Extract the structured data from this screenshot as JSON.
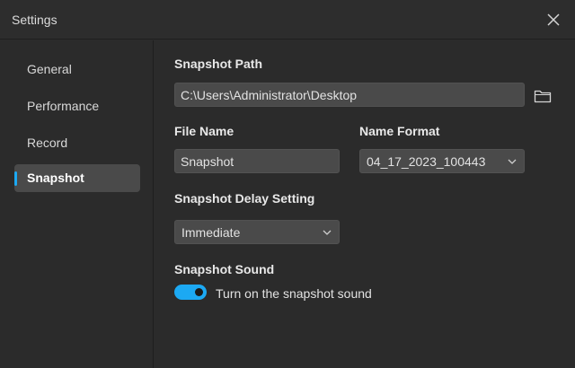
{
  "window": {
    "title": "Settings"
  },
  "sidebar": {
    "items": [
      {
        "label": "General",
        "active": false
      },
      {
        "label": "Performance",
        "active": false
      },
      {
        "label": "Record",
        "active": false
      },
      {
        "label": "Snapshot",
        "active": true
      }
    ]
  },
  "snapshot": {
    "path_label": "Snapshot Path",
    "path_value": "C:\\Users\\Administrator\\Desktop",
    "file_name_label": "File Name",
    "file_name_value": "Snapshot",
    "name_format_label": "Name Format",
    "name_format_value": "04_17_2023_100443",
    "delay_label": "Snapshot Delay Setting",
    "delay_value": "Immediate",
    "sound_label": "Snapshot Sound",
    "sound_toggle_text": "Turn on the snapshot sound",
    "sound_enabled": true
  },
  "colors": {
    "accent": "#1ca9f3",
    "background": "#2b2b2b",
    "control_bg": "#4a4a4a"
  },
  "icons": {
    "close": "close-icon",
    "folder": "folder-icon",
    "chevron": "chevron-down-icon"
  }
}
